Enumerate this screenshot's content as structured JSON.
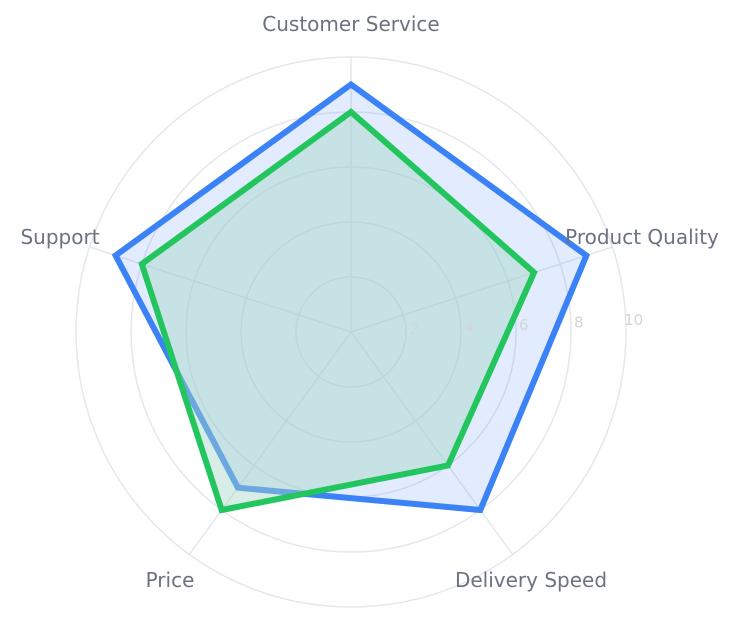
{
  "chart_data": {
    "type": "radar",
    "axes": [
      "Customer Service",
      "Product Quality",
      "Delivery Speed",
      "Price",
      "Support"
    ],
    "rlim": [
      0,
      10
    ],
    "ticks": [
      "2",
      "4",
      "6",
      "8",
      "10"
    ],
    "grid": true,
    "series": [
      {
        "values": [
          9,
          9,
          8,
          7,
          9
        ],
        "stroke": "#3b82f6",
        "fill": "#3b82f6",
        "fill_opacity": 0.15
      },
      {
        "values": [
          8,
          7,
          6,
          8,
          8
        ],
        "stroke": "#22c55e",
        "fill": "#a7d7c5",
        "fill_opacity": 0.45
      }
    ]
  }
}
